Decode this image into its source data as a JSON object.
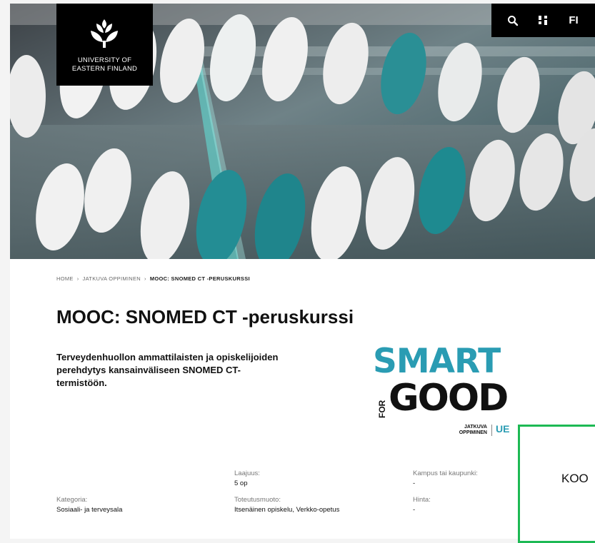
{
  "header": {
    "logo_line1": "UNIVERSITY OF",
    "logo_line2": "EASTERN FINLAND",
    "language": "FI",
    "icons": [
      "search-icon",
      "menu-icon"
    ]
  },
  "breadcrumb": {
    "home": "HOME",
    "parent": "JATKUVA OPPIMINEN",
    "current": "MOOC: SNOMED CT -PERUSKURSSI",
    "separator": "›"
  },
  "page": {
    "title": "MOOC: SNOMED CT -peruskurssi",
    "lead": "Terveydenhuollon ammattilaisten ja opiskelijoiden perehdytys kansainväliseen SNOMED CT-termistöön."
  },
  "badge": {
    "line1": "SMART",
    "for": "FOR",
    "line2": "GOOD",
    "sub1": "JATKUVA",
    "sub2": "OPPIMINEN",
    "brand": "UE",
    "colors": {
      "teal": "#2a9cb3",
      "black": "#111111"
    }
  },
  "info": {
    "scope": {
      "label": "Laajuus:",
      "value": "5 op"
    },
    "campus": {
      "label": "Kampus tai kaupunki:",
      "value": "-"
    },
    "category": {
      "label": "Kategoria:",
      "value": "Sosiaali- ja terveysala"
    },
    "format": {
      "label": "Toteutusmuoto:",
      "value": "Itsenäinen opiskelu, Verkko-opetus"
    },
    "price": {
      "label": "Hinta:",
      "value": "-"
    }
  },
  "popup": {
    "text": "KOO",
    "border_color": "#1db954"
  }
}
